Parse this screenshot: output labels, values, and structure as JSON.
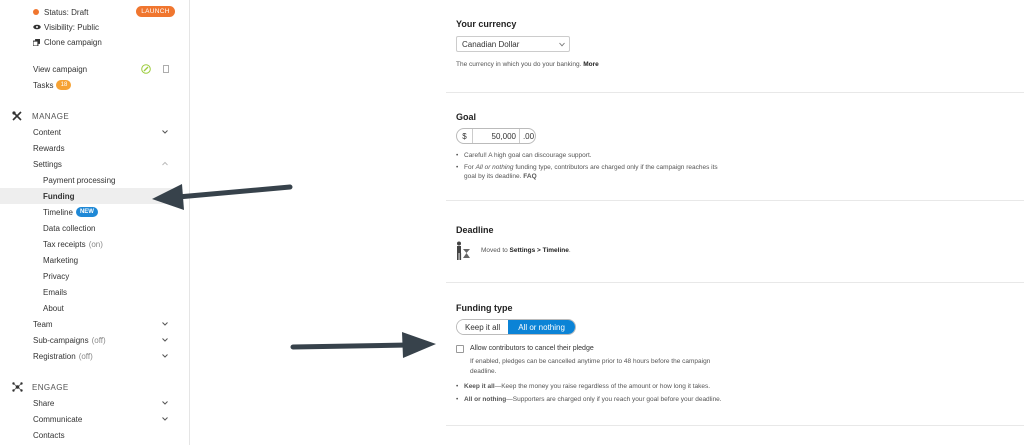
{
  "sidebar": {
    "status": {
      "label": "Status: Draft",
      "dot_color": "#f0762f"
    },
    "launch_label": "LAUNCH",
    "visibility": "Visibility: Public",
    "clone": "Clone campaign",
    "view_campaign": "View campaign",
    "tasks": {
      "label": "Tasks",
      "count": "18"
    },
    "manage_heading": "MANAGE",
    "content": "Content",
    "rewards": "Rewards",
    "settings": "Settings",
    "payment_processing": "Payment processing",
    "funding": "Funding",
    "timeline": {
      "label": "Timeline",
      "badge": "NEW"
    },
    "data_collection": "Data collection",
    "tax_receipts": {
      "label": "Tax receipts",
      "status": "(on)"
    },
    "marketing": "Marketing",
    "privacy": "Privacy",
    "emails": "Emails",
    "about": "About",
    "team": "Team",
    "sub_campaigns": {
      "label": "Sub-campaigns",
      "status": "(off)"
    },
    "registration": {
      "label": "Registration",
      "status": "(off)"
    },
    "engage_heading": "ENGAGE",
    "share": "Share",
    "communicate": "Communicate",
    "contacts": "Contacts"
  },
  "currency": {
    "title": "Your currency",
    "selected": "Canadian Dollar",
    "help": "The currency in which you do your banking.",
    "more": "More"
  },
  "goal": {
    "title": "Goal",
    "symbol": "$",
    "amount": "50,000",
    "cents": ".00",
    "bullet1": "Careful! A high goal can discourage support.",
    "bullet2_a": "For ",
    "bullet2_em": "All or nothing",
    "bullet2_b": " funding type, contributors are charged only if the campaign reaches its",
    "bullet2_line2": "goal by its deadline.",
    "faq": "FAQ"
  },
  "deadline": {
    "title": "Deadline",
    "moved_prefix": "Moved to ",
    "moved_target": "Settings > Timeline",
    "moved_suffix": "."
  },
  "funding_type": {
    "title": "Funding type",
    "option_keep": "Keep it all",
    "option_aon": "All or nothing",
    "selected": "All or nothing",
    "allow_cancel": "Allow contributors to cancel their pledge",
    "allow_cancel_checked": false,
    "allow_cancel_help_1": "If enabled, pledges can be cancelled anytime prior to 48 hours before the campaign",
    "allow_cancel_help_2": "deadline.",
    "keep_label": "Keep it all",
    "keep_desc": "—Keep the money you raise regardless of the amount or how long it takes.",
    "aon_label": "All or nothing",
    "aon_desc": "—Supporters are charged only if you reach your goal before your deadline."
  },
  "colors": {
    "accent_blue": "#0b83d6",
    "launch_orange": "#f0762f",
    "arrow": "#37424b"
  }
}
